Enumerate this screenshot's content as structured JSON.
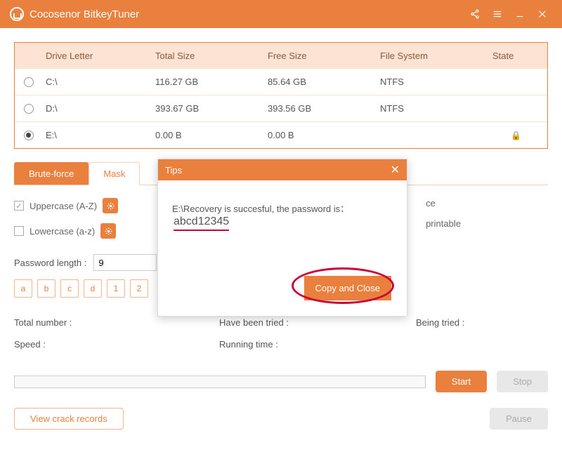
{
  "titlebar": {
    "title": "Cocosenor BitkeyTuner"
  },
  "driveTable": {
    "headers": {
      "letter": "Drive Letter",
      "total": "Total Size",
      "free": "Free Size",
      "fs": "File System",
      "state": "State"
    },
    "rows": [
      {
        "letter": "C:\\",
        "total": "116.27 GB",
        "free": "85.64 GB",
        "fs": "NTFS",
        "state": "",
        "selected": false
      },
      {
        "letter": "D:\\",
        "total": "393.67 GB",
        "free": "393.56 GB",
        "fs": "NTFS",
        "state": "",
        "selected": false
      },
      {
        "letter": "E:\\",
        "total": "0.00 B",
        "free": "0.00 B",
        "fs": "",
        "state": "locked",
        "selected": true
      }
    ]
  },
  "tabs": {
    "brute": "Brute-force",
    "mask": "Mask"
  },
  "options": {
    "uppercase": "Uppercase (A-Z)",
    "lowercase": "Lowercase (a-z)",
    "space_suffix": "ce",
    "printable_suffix": "printable"
  },
  "pwlen": {
    "label": "Password length :",
    "value": "9"
  },
  "chars": [
    "a",
    "b",
    "c",
    "d",
    "1",
    "2"
  ],
  "stats": {
    "total": "Total number :",
    "speed": "Speed :",
    "tried": "Have been tried :",
    "runtime": "Running time :",
    "being": "Being tried :"
  },
  "buttons": {
    "start": "Start",
    "stop": "Stop",
    "pause": "Pause",
    "records": "View crack records"
  },
  "modal": {
    "title": "Tips",
    "prefix": "E:\\Recovery is succesful, the password is：",
    "password": "abcd12345",
    "copy": "Copy and Close"
  }
}
